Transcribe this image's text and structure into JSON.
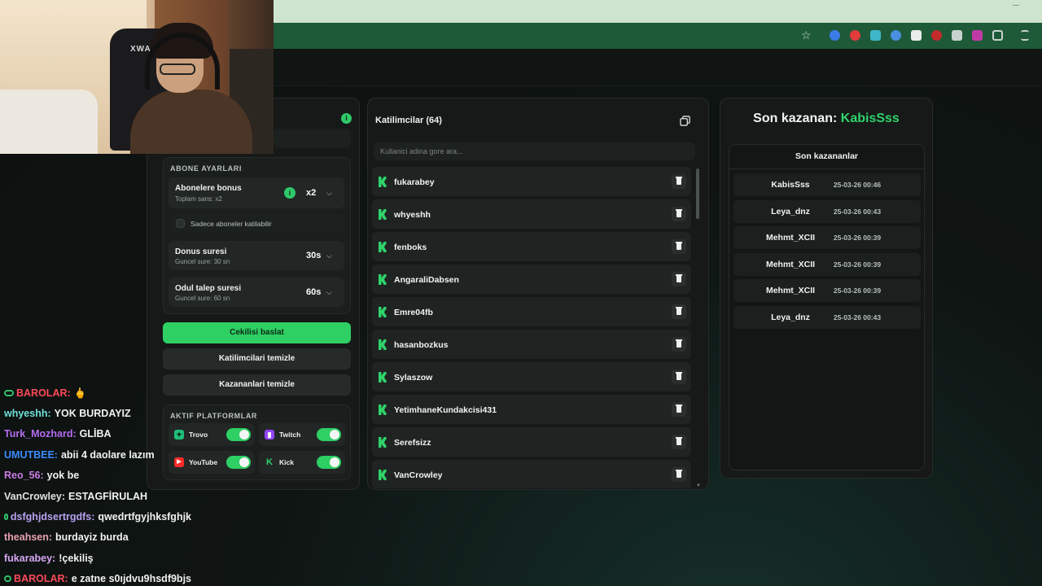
{
  "chat": [
    {
      "user": "BAROLAR:",
      "user_color": "#ff4a5a",
      "mod": true,
      "message": "🖕"
    },
    {
      "user": "whyeshh:",
      "user_color": "#6fe0d8",
      "mod": false,
      "message": "YOK BURDAYIZ"
    },
    {
      "user": "Turk_Mozhard:",
      "user_color": "#b46cf0",
      "mod": false,
      "message": "GLİBA"
    },
    {
      "user": "UMUTBEE:",
      "user_color": "#3a8cff",
      "mod": false,
      "message": "abii 4 daolare lazım"
    },
    {
      "user": "Reo_56:",
      "user_color": "#c97ae0",
      "mod": false,
      "message": "yok be"
    },
    {
      "user": "VanCrowley:",
      "user_color": "#e0e0e0",
      "mod": false,
      "message": "ESTAGFİRULAH"
    },
    {
      "user": "dsfghjdsertrgdfs:",
      "user_color": "#b9a1f2",
      "mod": true,
      "message": "qwedrtfgyjhksfghjk"
    },
    {
      "user": "theahsen:",
      "user_color": "#e8a0b0",
      "mod": false,
      "message": "burdayiz burda"
    },
    {
      "user": "fukarabey:",
      "user_color": "#d6a6f2",
      "mod": false,
      "message": "!çekiliş"
    },
    {
      "user": "BAROLAR:",
      "user_color": "#ff4a5a",
      "mod": true,
      "message": "e zatne s0ıjdvu9hsdf9bjs"
    }
  ],
  "webcam": {
    "chair_label": "XWAH"
  },
  "settings": {
    "status_icon": "i",
    "subscriber_section": "ABONE AYARLARI",
    "bonus_title": "Abonelere bonus",
    "bonus_sub": "Toplam sans: x2",
    "bonus_value": "x2",
    "subs_only_label": "Sadece aboneler katilabilir",
    "duration_title": "Donus suresi",
    "duration_sub": "Guncel sure: 30 sn",
    "duration_value": "30s",
    "claim_title": "Odul talep suresi",
    "claim_sub": "Guncel sure: 60 sn",
    "claim_value": "60s",
    "start_button": "Cekilisi baslat",
    "clear_participants_button": "Katilimcilari temizle",
    "clear_winners_button": "Kazananlari temizle",
    "platforms_section": "AKTIF PLATFORMLAR",
    "platforms": [
      {
        "name": "Trovo",
        "icon": "trovo-icon",
        "color": "#1fbf7a",
        "enabled": true
      },
      {
        "name": "Twitch",
        "icon": "twitch-icon",
        "color": "#9146ff",
        "enabled": true
      },
      {
        "name": "YouTube",
        "icon": "youtube-icon",
        "color": "#ff2a2a",
        "enabled": true
      },
      {
        "name": "Kick",
        "icon": "kick-icon",
        "color": "#2fd36b",
        "enabled": true
      }
    ]
  },
  "participants": {
    "title": "Katilimcilar (64)",
    "search_placeholder": "Kullanici adina gore ara...",
    "list": [
      "fukarabey",
      "whyeshh",
      "fenboks",
      "AngaraliDabsen",
      "Emre04fb",
      "hasanbozkus",
      "Sylaszow",
      "YetimhaneKundakcisi431",
      "Serefsizz",
      "VanCrowley"
    ]
  },
  "winners": {
    "last_label": "Son kazanan:",
    "last_name": "KabisSss",
    "list_title": "Son kazananlar",
    "list": [
      {
        "name": "KabisSss",
        "time": "25-03-26 00:46"
      },
      {
        "name": "Leya_dnz",
        "time": "25-03-26 00:43"
      },
      {
        "name": "Mehmt_XCII",
        "time": "25-03-26 00:39"
      },
      {
        "name": "Mehmt_XCII",
        "time": "25-03-26 00:39"
      },
      {
        "name": "Mehmt_XCII",
        "time": "25-03-26 00:39"
      },
      {
        "name": "Leya_dnz",
        "time": "25-03-26 00:43"
      }
    ]
  },
  "colors": {
    "accent": "#2ecf63",
    "browser_toolbar": "#1e5a38"
  }
}
